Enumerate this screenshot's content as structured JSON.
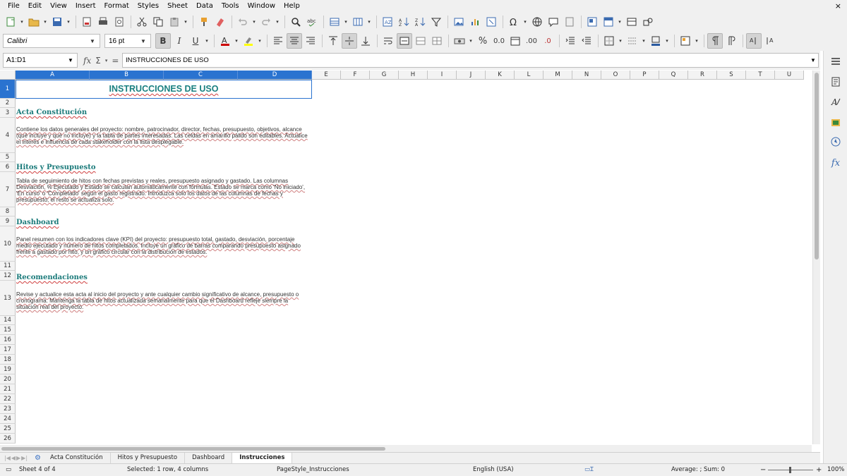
{
  "menu": [
    "File",
    "Edit",
    "View",
    "Insert",
    "Format",
    "Styles",
    "Sheet",
    "Data",
    "Tools",
    "Window",
    "Help"
  ],
  "close_glyph": "×",
  "font_name": "Calibri",
  "font_size": "16 pt",
  "name_box": "A1:D1",
  "formula": "INSTRUCCIONES DE USO",
  "columns": [
    "A",
    "B",
    "C",
    "D",
    "E",
    "F",
    "G",
    "H",
    "I",
    "J",
    "K",
    "L",
    "M",
    "N",
    "O",
    "P",
    "Q",
    "R",
    "S",
    "T",
    "U"
  ],
  "rows": [
    "1",
    "2",
    "3",
    "4",
    "5",
    "6",
    "7",
    "8",
    "9",
    "10",
    "11",
    "12",
    "13",
    "14",
    "15",
    "16",
    "17",
    "18",
    "19",
    "20",
    "21",
    "22",
    "23",
    "24",
    "25",
    "26"
  ],
  "title": "INSTRUCCIONES DE USO",
  "sections": [
    {
      "heading": "Acta Constitución",
      "body": "Contiene los datos generales del proyecto: nombre, patrocinador, director, fechas, presupuesto, objetivos, alcance (qué incluye y qué no incluye) y la tabla de partes interesadas. Las celdas en amarillo pálido son editables. Actualice el interés e influencia de cada stakeholder con la lista desplegable."
    },
    {
      "heading": "Hitos y Presupuesto",
      "body": "Tabla de seguimiento de hitos con fechas previstas y reales, presupuesto asignado y gastado. Las columnas Desviación, % Ejecutado y Estado se calculan automáticamente con fórmulas. Estado se marca como 'No iniciado', 'En curso' o 'Completado' según el gasto registrado. Introduzca solo los datos de las columnas de fechas y presupuesto; el resto se actualiza solo."
    },
    {
      "heading": "Dashboard",
      "body": "Panel resumen con los indicadores clave (KPI) del proyecto: presupuesto total, gastado, desviación, porcentaje medio ejecutado y número de hitos completados. Incluye un gráfico de barras comparando presupuesto asignado frente a gastado por hito, y un gráfico circular con la distribución de estados."
    },
    {
      "heading": "Recomendaciones",
      "body": "Revise y actualice esta acta al inicio del proyecto y ante cualquier cambio significativo de alcance, presupuesto o cronograma. Mantenga la tabla de hitos actualizada semanalmente para que el Dashboard refleje siempre la situación real del proyecto."
    }
  ],
  "tabs": [
    "Acta Constitución",
    "Hitos y Presupuesto",
    "Dashboard",
    "Instrucciones"
  ],
  "active_tab": "Instrucciones",
  "status": {
    "sheet": "Sheet 4 of 4",
    "selection": "Selected: 1 row, 4 columns",
    "page_style": "PageStyle_Instrucciones",
    "language": "English (USA)",
    "sum": "Average: ; Sum: 0",
    "zoom_minus": "−",
    "zoom_plus": "+",
    "zoom": "100%"
  },
  "colors": {
    "accent": "#2a73d0",
    "heading": "#1a7a7a",
    "title": "#1a8080"
  }
}
